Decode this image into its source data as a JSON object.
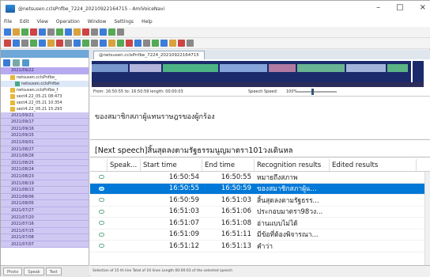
{
  "window": {
    "title": "@netsusen.cclsPnfbe_7224_20210922164715 - AmiVoiceNavi",
    "controls": [
      "–",
      "□",
      "×"
    ]
  },
  "menu": [
    "File",
    "Edit",
    "View",
    "Operation",
    "Window",
    "Settings",
    "Help"
  ],
  "tree": {
    "items": [
      "netsusen.cclsPnfbe_",
      "netsusen.cclsPnfbe",
      "netsusen.cclsPnfbe_f",
      "sect4.22_05.21 08:473",
      "sect4.22_05.21 10:354",
      "sect4.22_05.21 15:293"
    ],
    "dates": [
      "2021/09/22",
      "2021/09/21",
      "2021/09/17",
      "2021/09/16",
      "2021/09/15",
      "2021/09/01",
      "2021/08/27",
      "2021/08/26",
      "2021/08/25",
      "2021/08/24",
      "2021/08/23",
      "2021/08/19",
      "2021/08/13",
      "2021/08/06",
      "2021/08/05",
      "2021/07/27",
      "2021/07/20",
      "2021/07/16",
      "2021/07/15",
      "2021/07/08",
      "2021/07/07"
    ],
    "tabs": [
      "Photo",
      "Speak",
      "Text"
    ]
  },
  "doc": {
    "tab_label": "@netsusen.cclsPnfbe_7224_20210922164715",
    "info_left": "From: 16:50:55 to: 16:50:59 length: 00:00:03",
    "speed_label": "Speech Speed:",
    "speed_value": "100%",
    "speed_fraction": 0.36,
    "text1": "ของสมาชิกสภาผู้แทนราษฎรของผู้กร้อง",
    "text2": "[Next speech]สิ้นสุดลงตามรัฐธรรมนูญมาตรา101วงเดินหล"
  },
  "grid": {
    "headers": [
      "",
      "Speak...",
      "Start time",
      "End time",
      "Recognition results",
      "Edited results"
    ],
    "rows": [
      {
        "start": "16:50:54",
        "end": "16:50:55",
        "text": "หมายถึงสภาพ",
        "edited": "",
        "selected": false
      },
      {
        "start": "16:50:55",
        "end": "16:50:59",
        "text": "ของสมาชิกสภาผู้แ...",
        "edited": "",
        "selected": true
      },
      {
        "start": "16:50:59",
        "end": "16:51:03",
        "text": "สิ้นสุดลงตามรัฐธรร...",
        "edited": "",
        "selected": false
      },
      {
        "start": "16:51:03",
        "end": "16:51:06",
        "text": "ประกอบมาตรา98วง...",
        "edited": "",
        "selected": false
      },
      {
        "start": "16:51:07",
        "end": "16:51:08",
        "text": "อ่านแบบไม่ได้",
        "edited": "",
        "selected": false
      },
      {
        "start": "16:51:09",
        "end": "16:51:11",
        "text": "มีข้อที่ต้องพิจารณา...",
        "edited": "",
        "selected": false
      },
      {
        "start": "16:51:12",
        "end": "16:51:13",
        "text": "คำว่า",
        "edited": "",
        "selected": false
      }
    ]
  },
  "status": {
    "text": "Selection of   15 th line  Total of 10 lines  Length 00:00:03 of the selected speech"
  },
  "colors": {
    "selection": "#0078d7",
    "date_row": "#cfc8f2",
    "waveform_bg": "#1b2a6a"
  }
}
